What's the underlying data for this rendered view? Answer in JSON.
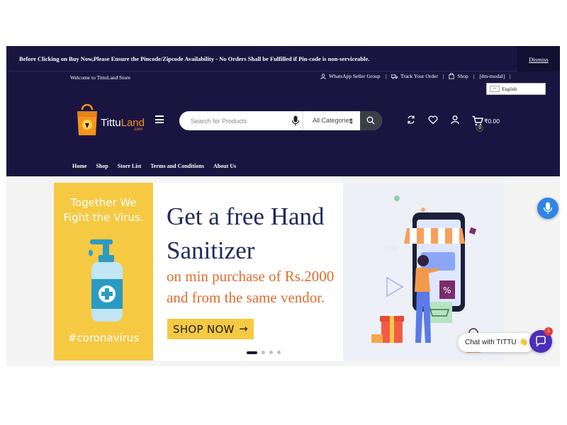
{
  "notice": {
    "text": "Before Clicking on Buy Now,Please Ensure the Pincode/Zipcode Availability - No Orders Shall be Fulfilled if Pin-code is non-serviceable.",
    "dismiss": "Dismiss"
  },
  "topbar": {
    "welcome": "Welcome to TittuLand Store",
    "links": [
      {
        "label": "WhatsApp Seller Group",
        "icon": "user-icon"
      },
      {
        "label": "Track Your Order",
        "icon": "truck-icon"
      },
      {
        "label": "Shop",
        "icon": "bag-icon"
      },
      {
        "label": "[dm-modal]",
        "icon": ""
      }
    ],
    "separator": "|",
    "language": {
      "flag_alt": "en",
      "label": "English"
    }
  },
  "logo": {
    "part1": "Tittu",
    "part2": "Land",
    "suffix": ".com"
  },
  "search": {
    "placeholder": "Search for Products",
    "category": "All Categories"
  },
  "cart": {
    "count": "0",
    "total": "₹0.00"
  },
  "nav": [
    "Home",
    "Shop",
    "Store List",
    "Terms and Conditions",
    "About Us"
  ],
  "banner": {
    "left_title_line1": "Together We",
    "left_title_line2": "Fight the Virus.",
    "hashtag": "#coronavirus",
    "headline_line1": "Get a free Hand",
    "headline_line2": "Sanitizer",
    "sub_line1": "on min purchase of Rs.2000",
    "sub_line2": "and from the same vendor.",
    "cta": "SHOP NOW",
    "cta_arrow": "→",
    "slides_total": 4,
    "slide_active": 1
  },
  "chat": {
    "label": "Chat with TITTU",
    "emoji": "👋",
    "unread": "1"
  },
  "colors": {
    "header_bg": "#1a1540",
    "accent_orange": "#f7941d",
    "banner_yellow": "#f6c943",
    "headline_navy": "#1f2a5c",
    "sub_orange": "#e36c2b",
    "chat_purple": "#4b2fb8",
    "voice_blue": "#2f84e6"
  }
}
